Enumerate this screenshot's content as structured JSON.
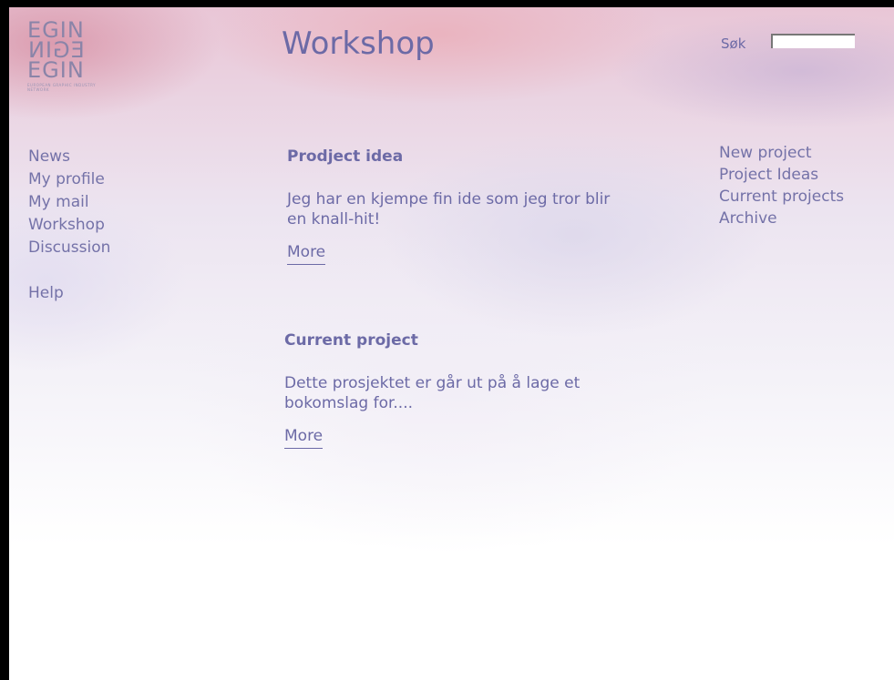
{
  "logo": {
    "line1": "EGIN",
    "line2": "EGIN",
    "line3": "EGIN",
    "tagline": "EUROPEAN GRAPHIC INDUSTRY NETWORK"
  },
  "header": {
    "title": "Workshop",
    "search_label": "Søk",
    "search_value": ""
  },
  "nav_left": {
    "items": [
      "News",
      "My profile",
      "My mail",
      "Workshop",
      "Discussion"
    ],
    "help": "Help"
  },
  "nav_right": {
    "items": [
      "New project",
      "Project Ideas",
      "Current projects",
      "Archive"
    ]
  },
  "main": {
    "sections": [
      {
        "heading": "Prodject idea",
        "text": "Jeg har en kjempe fin ide som jeg tror blir en knall-hit!",
        "link": "More"
      },
      {
        "heading": "Current project",
        "text": "Dette prosjektet er går ut på å lage et bokomslag for....",
        "link": "More"
      }
    ]
  },
  "colors": {
    "text": "#6c6aa6",
    "nav": "#7472a8",
    "logo": "#8a84a8"
  }
}
